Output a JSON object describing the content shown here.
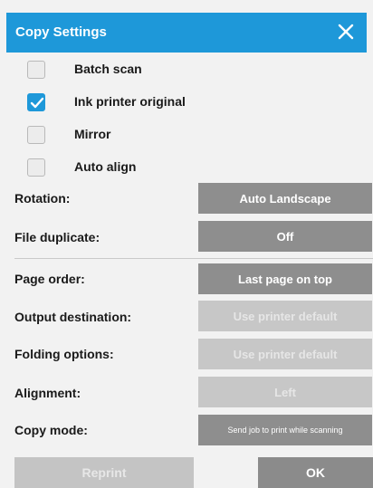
{
  "dialog": {
    "title": "Copy Settings",
    "close_label": "close"
  },
  "options": [
    {
      "label": "Batch scan",
      "checked": false
    },
    {
      "label": "Ink printer original",
      "checked": true
    },
    {
      "label": "Mirror",
      "checked": false
    },
    {
      "label": "Auto align",
      "checked": false
    }
  ],
  "fields": {
    "rotation": {
      "label": "Rotation:",
      "value": "Auto Landscape",
      "enabled": true
    },
    "file_duplicate": {
      "label": "File duplicate:",
      "value": "Off",
      "enabled": true
    },
    "page_order": {
      "label": "Page order:",
      "value": "Last page on top",
      "enabled": true
    },
    "output_destination": {
      "label": "Output destination:",
      "value": "Use printer default",
      "enabled": false
    },
    "folding_options": {
      "label": "Folding options:",
      "value": "Use printer default",
      "enabled": false
    },
    "alignment": {
      "label": "Alignment:",
      "value": "Left",
      "enabled": false
    },
    "copy_mode": {
      "label": "Copy mode:",
      "value": "Send job to print while scanning",
      "enabled": true
    }
  },
  "footer": {
    "reprint_label": "Reprint",
    "ok_label": "OK"
  },
  "colors": {
    "accent": "#1e98d9",
    "button": "#8e8e8e",
    "button_disabled": "#c7c7c7",
    "background": "#f2f2f2"
  }
}
